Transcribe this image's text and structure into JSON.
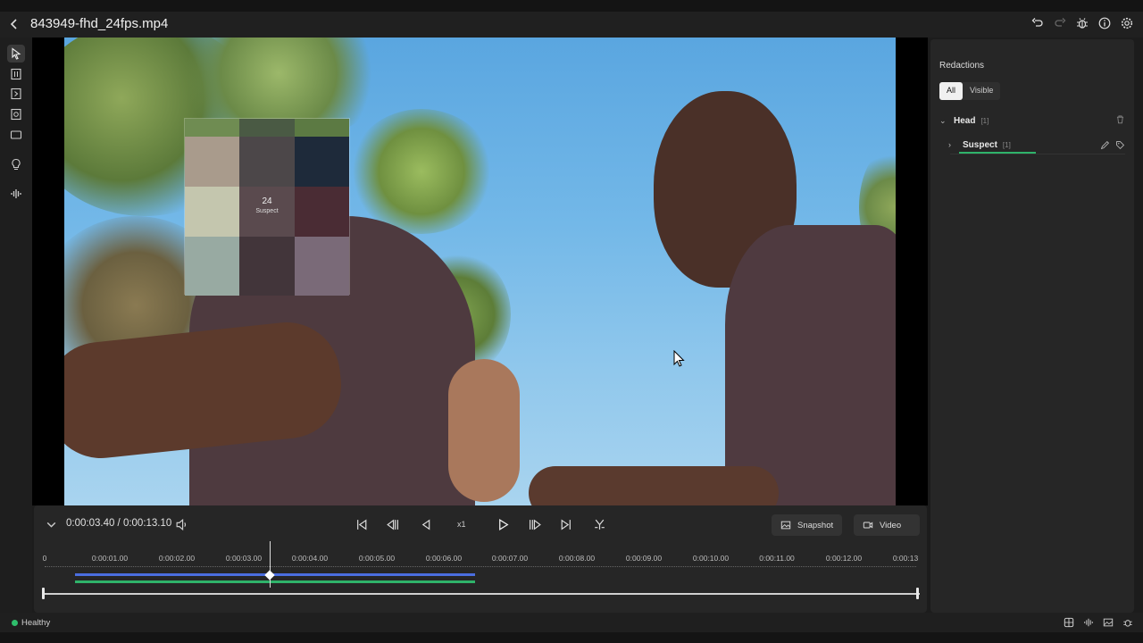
{
  "app": {
    "file_title": "843949-fhd_24fps.mp4"
  },
  "top_icons": [
    "undo-icon",
    "redo-icon",
    "bug-icon",
    "info-icon",
    "settings-icon"
  ],
  "left_tools": [
    "pointer-icon",
    "bracket-select-icon",
    "forward-track-icon",
    "face-detect-icon",
    "rectangle-icon",
    "lightbulb-icon",
    "audio-waveform-icon"
  ],
  "redaction_box": {
    "id_text": "24",
    "label": "Suspect",
    "colors": [
      "#6f8c52",
      "#4a5a44",
      "#5c7a43",
      "#a99b8c",
      "#4c4749",
      "#1e2a3a",
      "#c4c6ae",
      "#5a4a4e",
      "#4a2c34",
      "#98aaa2",
      "#42353a",
      "#7a6a78"
    ]
  },
  "controls": {
    "current_time": "0:00:03.40 / 0:00:13.10",
    "speed": "x1",
    "snapshot_label": "Snapshot",
    "video_label": "Video"
  },
  "timeline": {
    "ticks": [
      "0",
      "0:00:01.00",
      "0:00:02.00",
      "0:00:03.00",
      "0:00:04.00",
      "0:00:05.00",
      "0:00:06.00",
      "0:00:07.00",
      "0:00:08.00",
      "0:00:09.00",
      "0:00:10.00",
      "0:00:11.00",
      "0:00:12.00",
      "0:00:13"
    ],
    "track_colors": {
      "blue": "#4a6ee0",
      "green": "#2fb36a"
    }
  },
  "panel": {
    "title": "Redactions",
    "filter_all": "All",
    "filter_visible": "Visible",
    "group_name": "Head",
    "group_count": "[1]",
    "item_name": "Suspect",
    "item_count": "[1]"
  },
  "status": {
    "health": "Healthy",
    "health_color": "#2ebd6b"
  }
}
